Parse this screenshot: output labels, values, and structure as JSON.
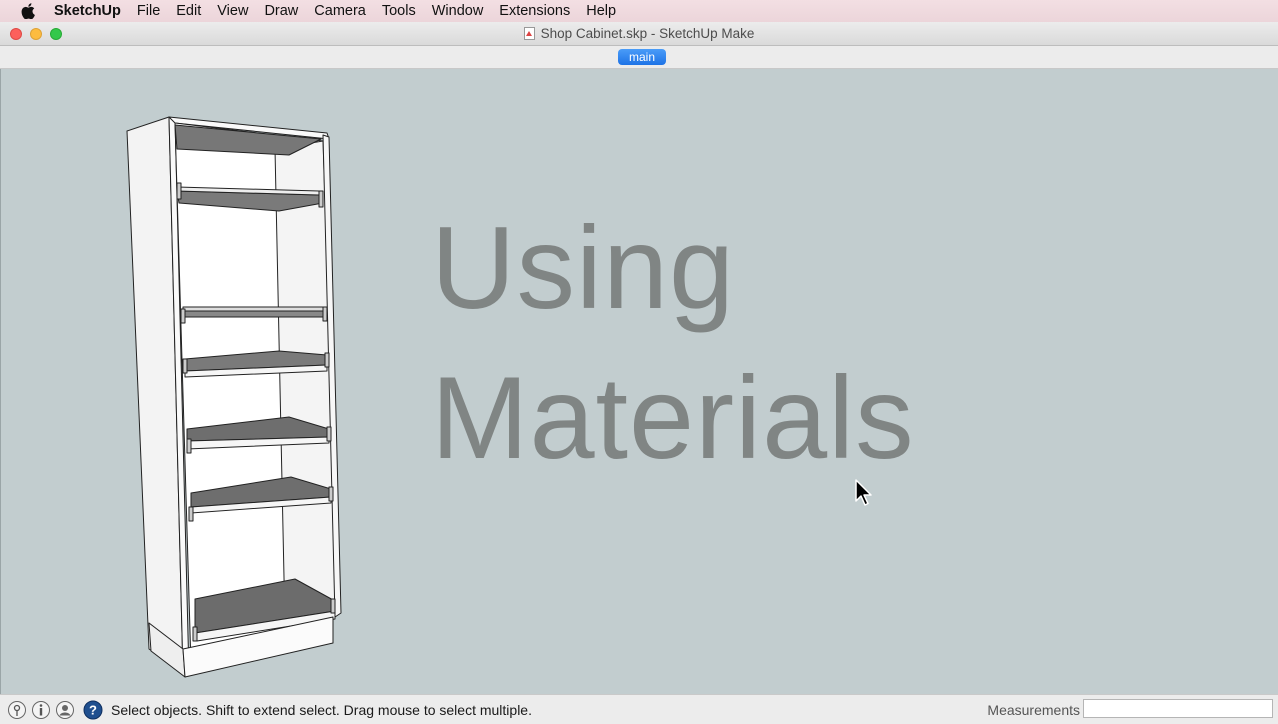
{
  "menubar": {
    "app_name": "SketchUp",
    "items": [
      "File",
      "Edit",
      "View",
      "Draw",
      "Camera",
      "Tools",
      "Window",
      "Extensions",
      "Help"
    ]
  },
  "window": {
    "title": "Shop Cabinet.skp - SketchUp Make"
  },
  "scene_tabs": [
    "main"
  ],
  "viewport": {
    "overlay_line1": "Using",
    "overlay_line2": "Materials",
    "background_color": "#c2cdcf",
    "overlay_color": "#808584"
  },
  "status": {
    "icons": [
      "geo-location-icon",
      "credits-icon",
      "user-account-icon",
      "instructor-help-icon"
    ],
    "message": "Select objects. Shift to extend select. Drag mouse to select multiple.",
    "measurements_label": "Measurements",
    "measurements_value": ""
  },
  "colors": {
    "scene_tab": "#1e73e6",
    "close": "#fc605c",
    "minimize": "#fdbc40",
    "maximize": "#34c84a"
  }
}
